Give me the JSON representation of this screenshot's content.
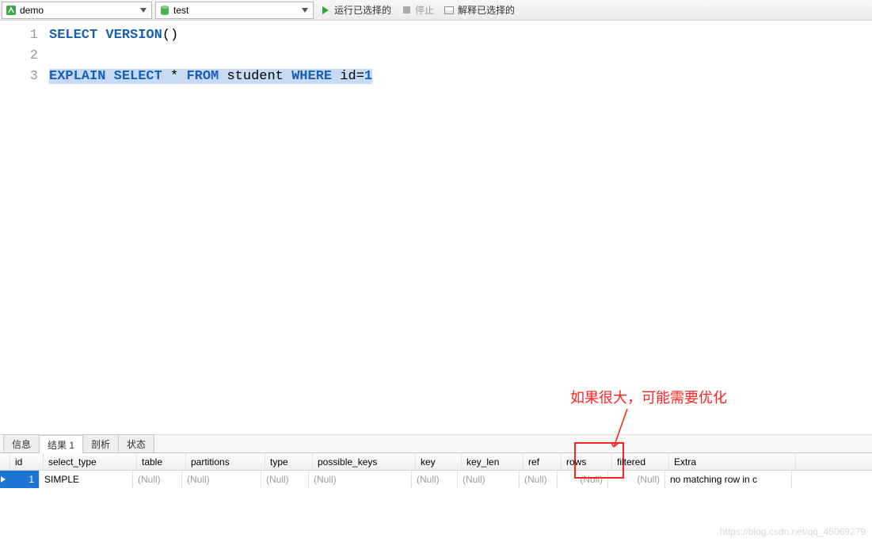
{
  "toolbar": {
    "database": "demo",
    "schema": "test",
    "run_label": "运行已选择的",
    "stop_label": "停止",
    "explain_label": "解释已选择的"
  },
  "editor": {
    "lines": [
      {
        "n": "1",
        "tokens": [
          {
            "t": "SELECT",
            "c": "kw"
          },
          {
            "t": " ",
            "c": ""
          },
          {
            "t": "VERSION",
            "c": "fn"
          },
          {
            "t": "()",
            "c": "id"
          }
        ],
        "selected": false
      },
      {
        "n": "2",
        "tokens": [],
        "selected": false
      },
      {
        "n": "3",
        "tokens": [
          {
            "t": "EXPLAIN",
            "c": "kw"
          },
          {
            "t": " ",
            "c": ""
          },
          {
            "t": "SELECT",
            "c": "kw"
          },
          {
            "t": " * ",
            "c": "id"
          },
          {
            "t": "FROM",
            "c": "kw"
          },
          {
            "t": " student ",
            "c": "id"
          },
          {
            "t": "WHERE",
            "c": "kw"
          },
          {
            "t": " id=",
            "c": "id"
          },
          {
            "t": "1",
            "c": "num"
          }
        ],
        "selected": true
      }
    ]
  },
  "annotation": {
    "text": "如果很大，可能需要优化"
  },
  "tabs": {
    "items": [
      {
        "label": "信息",
        "active": false
      },
      {
        "label": "结果 1",
        "active": true
      },
      {
        "label": "剖析",
        "active": false
      },
      {
        "label": "状态",
        "active": false
      }
    ]
  },
  "result": {
    "columns": [
      "id",
      "select_type",
      "table",
      "partitions",
      "type",
      "possible_keys",
      "key",
      "key_len",
      "ref",
      "rows",
      "filtered",
      "Extra"
    ],
    "rows": [
      {
        "id": "1",
        "select_type": "SIMPLE",
        "table": "(Null)",
        "partitions": "(Null)",
        "type": "(Null)",
        "possible_keys": "(Null)",
        "key": "(Null)",
        "key_len": "(Null)",
        "ref": "(Null)",
        "rows": "(Null)",
        "filtered": "(Null)",
        "Extra": "no matching row in c"
      }
    ]
  },
  "watermark": "https://blog.csdn.net/qq_45069279"
}
